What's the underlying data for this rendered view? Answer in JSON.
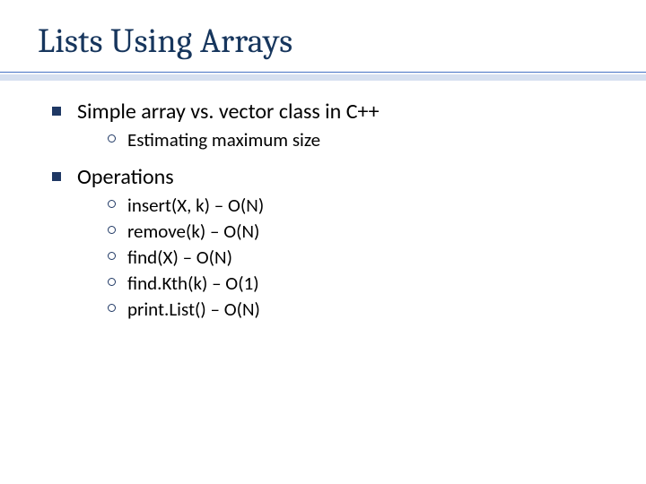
{
  "title": "Lists Using Arrays",
  "items": [
    {
      "label": "Simple array vs. vector class in C++",
      "sub": [
        "Estimating maximum size"
      ]
    },
    {
      "label": "Operations",
      "sub": [
        "insert(X, k) – O(N)",
        "remove(k) – O(N)",
        "find(X) – O(N)",
        "find.Kth(k) – O(1)",
        "print.List() – O(N)"
      ]
    }
  ]
}
